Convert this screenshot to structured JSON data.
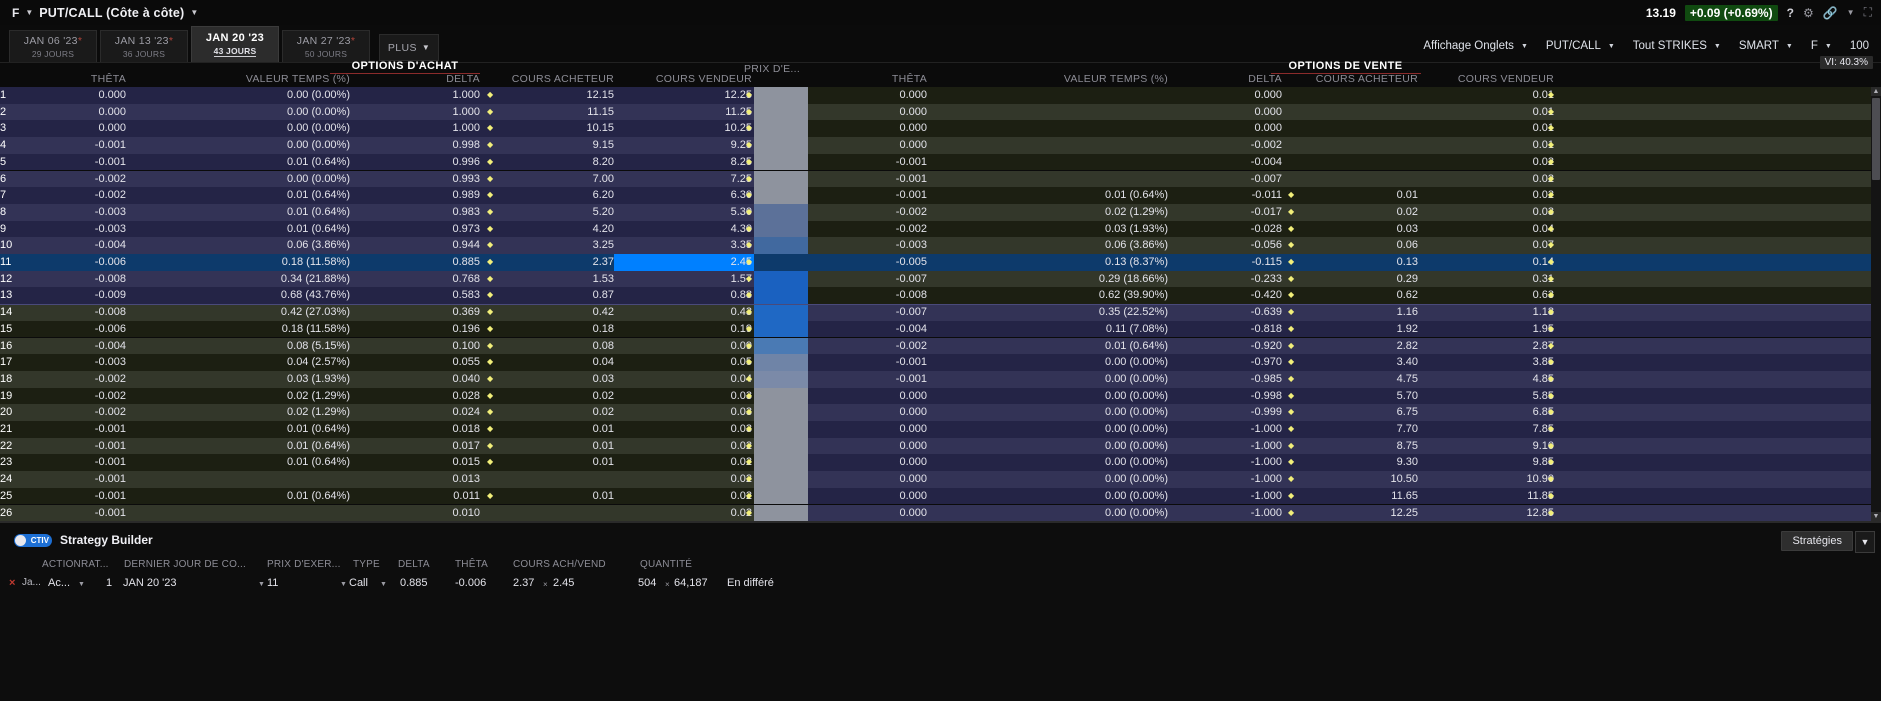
{
  "titlebar": {
    "symbol": "F",
    "title": "PUT/CALL (Côte à côte)",
    "quote_last": "13.19",
    "quote_change": "+0.09  (+0.69%)",
    "change_bg": "#104a10",
    "help_icon": "?",
    "gear_icon": "gear-icon",
    "link_icon": "link-icon",
    "expand_icon": "expand-icon"
  },
  "expiry_tabs": [
    {
      "date": "JAN 06 '23",
      "days": "29 JOURS",
      "selected": false,
      "asterisk": true
    },
    {
      "date": "JAN 13 '23",
      "days": "36 JOURS",
      "selected": false,
      "asterisk": true
    },
    {
      "date": "JAN 20 '23",
      "days": "43 JOURS",
      "selected": true,
      "asterisk": false
    },
    {
      "date": "JAN 27 '23",
      "days": "50 JOURS",
      "selected": false,
      "asterisk": true
    }
  ],
  "plus_tab": "PLUS",
  "toolbar": {
    "display_mode": "Affichage Onglets",
    "option_type": "PUT/CALL",
    "strikes": "Tout STRIKES",
    "exchange": "SMART",
    "symbol": "F",
    "quantity": "100",
    "vi_badge": "VI: 40.3%"
  },
  "sections": {
    "calls_title": "OPTIONS D'ACHAT",
    "puts_title": "OPTIONS DE VENTE",
    "strike_header": "PRIX D'E..."
  },
  "columns": {
    "theta": "THÊTA",
    "time_value": "VALEUR TEMPS (%)",
    "delta": "DELTA",
    "bid": "COURS ACHETEUR",
    "ask": "COURS VENDEUR"
  },
  "rows": [
    {
      "strike": "1",
      "c_theta": "0.000",
      "c_vt": "0.00 (0.00%)",
      "c_delta": "1.000",
      "c_bid": "12.15",
      "c_ask": "12.25",
      "p_theta": "0.000",
      "p_vt": "",
      "p_delta": "0.000",
      "p_bid": "",
      "p_ask": "0.01"
    },
    {
      "strike": "2",
      "c_theta": "0.000",
      "c_vt": "0.00 (0.00%)",
      "c_delta": "1.000",
      "c_bid": "11.15",
      "c_ask": "11.25",
      "p_theta": "0.000",
      "p_vt": "",
      "p_delta": "0.000",
      "p_bid": "",
      "p_ask": "0.01"
    },
    {
      "strike": "3",
      "c_theta": "0.000",
      "c_vt": "0.00 (0.00%)",
      "c_delta": "1.000",
      "c_bid": "10.15",
      "c_ask": "10.25",
      "p_theta": "0.000",
      "p_vt": "",
      "p_delta": "0.000",
      "p_bid": "",
      "p_ask": "0.01"
    },
    {
      "strike": "4",
      "c_theta": "-0.001",
      "c_vt": "0.00 (0.00%)",
      "c_delta": "0.998",
      "c_bid": "9.15",
      "c_ask": "9.25",
      "p_theta": "0.000",
      "p_vt": "",
      "p_delta": "-0.002",
      "p_bid": "",
      "p_ask": "0.01"
    },
    {
      "strike": "5",
      "c_theta": "-0.001",
      "c_vt": "0.01 (0.64%)",
      "c_delta": "0.996",
      "c_bid": "8.20",
      "c_ask": "8.25",
      "p_theta": "-0.001",
      "p_vt": "",
      "p_delta": "-0.004",
      "p_bid": "",
      "p_ask": "0.02"
    },
    {
      "strike": "6",
      "c_theta": "-0.002",
      "c_vt": "0.00 (0.00%)",
      "c_delta": "0.993",
      "c_bid": "7.00",
      "c_ask": "7.25",
      "p_theta": "-0.001",
      "p_vt": "",
      "p_delta": "-0.007",
      "p_bid": "",
      "p_ask": "0.02"
    },
    {
      "strike": "7",
      "c_theta": "-0.002",
      "c_vt": "0.01 (0.64%)",
      "c_delta": "0.989",
      "c_bid": "6.20",
      "c_ask": "6.30",
      "p_theta": "-0.001",
      "p_vt": "0.01 (0.64%)",
      "p_delta": "-0.011",
      "p_bid": "0.01",
      "p_ask": "0.02"
    },
    {
      "strike": "8",
      "c_theta": "-0.003",
      "c_vt": "0.01 (0.64%)",
      "c_delta": "0.983",
      "c_bid": "5.20",
      "c_ask": "5.30",
      "p_theta": "-0.002",
      "p_vt": "0.02 (1.29%)",
      "p_delta": "-0.017",
      "p_bid": "0.02",
      "p_ask": "0.03"
    },
    {
      "strike": "9",
      "c_theta": "-0.003",
      "c_vt": "0.01 (0.64%)",
      "c_delta": "0.973",
      "c_bid": "4.20",
      "c_ask": "4.30",
      "p_theta": "-0.002",
      "p_vt": "0.03 (1.93%)",
      "p_delta": "-0.028",
      "p_bid": "0.03",
      "p_ask": "0.04"
    },
    {
      "strike": "10",
      "c_theta": "-0.004",
      "c_vt": "0.06 (3.86%)",
      "c_delta": "0.944",
      "c_bid": "3.25",
      "c_ask": "3.35",
      "p_theta": "-0.003",
      "p_vt": "0.06 (3.86%)",
      "p_delta": "-0.056",
      "p_bid": "0.06",
      "p_ask": "0.07"
    },
    {
      "strike": "11",
      "c_theta": "-0.006",
      "c_vt": "0.18 (11.58%)",
      "c_delta": "0.885",
      "c_bid": "2.37",
      "c_ask": "2.45",
      "p_theta": "-0.005",
      "p_vt": "0.13 (8.37%)",
      "p_delta": "-0.115",
      "p_bid": "0.13",
      "p_ask": "0.14",
      "selected": true
    },
    {
      "strike": "12",
      "c_theta": "-0.008",
      "c_vt": "0.34 (21.88%)",
      "c_delta": "0.768",
      "c_bid": "1.53",
      "c_ask": "1.57",
      "p_theta": "-0.007",
      "p_vt": "0.29 (18.66%)",
      "p_delta": "-0.233",
      "p_bid": "0.29",
      "p_ask": "0.31"
    },
    {
      "strike": "13",
      "c_theta": "-0.009",
      "c_vt": "0.68 (43.76%)",
      "c_delta": "0.583",
      "c_bid": "0.87",
      "c_ask": "0.88",
      "p_theta": "-0.008",
      "p_vt": "0.62 (39.90%)",
      "p_delta": "-0.420",
      "p_bid": "0.62",
      "p_ask": "0.63"
    },
    {
      "strike": "14",
      "c_theta": "-0.008",
      "c_vt": "0.42 (27.03%)",
      "c_delta": "0.369",
      "c_bid": "0.42",
      "c_ask": "0.43",
      "p_theta": "-0.007",
      "p_vt": "0.35 (22.52%)",
      "p_delta": "-0.639",
      "p_bid": "1.16",
      "p_ask": "1.18"
    },
    {
      "strike": "15",
      "c_theta": "-0.006",
      "c_vt": "0.18 (11.58%)",
      "c_delta": "0.196",
      "c_bid": "0.18",
      "c_ask": "0.19",
      "p_theta": "-0.004",
      "p_vt": "0.11 (7.08%)",
      "p_delta": "-0.818",
      "p_bid": "1.92",
      "p_ask": "1.95"
    },
    {
      "strike": "16",
      "c_theta": "-0.004",
      "c_vt": "0.08 (5.15%)",
      "c_delta": "0.100",
      "c_bid": "0.08",
      "c_ask": "0.09",
      "p_theta": "-0.002",
      "p_vt": "0.01 (0.64%)",
      "p_delta": "-0.920",
      "p_bid": "2.82",
      "p_ask": "2.87"
    },
    {
      "strike": "17",
      "c_theta": "-0.003",
      "c_vt": "0.04 (2.57%)",
      "c_delta": "0.055",
      "c_bid": "0.04",
      "c_ask": "0.05",
      "p_theta": "-0.001",
      "p_vt": "0.00 (0.00%)",
      "p_delta": "-0.970",
      "p_bid": "3.40",
      "p_ask": "3.85"
    },
    {
      "strike": "18",
      "c_theta": "-0.002",
      "c_vt": "0.03 (1.93%)",
      "c_delta": "0.040",
      "c_bid": "0.03",
      "c_ask": "0.04",
      "p_theta": "-0.001",
      "p_vt": "0.00 (0.00%)",
      "p_delta": "-0.985",
      "p_bid": "4.75",
      "p_ask": "4.85"
    },
    {
      "strike": "19",
      "c_theta": "-0.002",
      "c_vt": "0.02 (1.29%)",
      "c_delta": "0.028",
      "c_bid": "0.02",
      "c_ask": "0.03",
      "p_theta": "0.000",
      "p_vt": "0.00 (0.00%)",
      "p_delta": "-0.998",
      "p_bid": "5.70",
      "p_ask": "5.85"
    },
    {
      "strike": "20",
      "c_theta": "-0.002",
      "c_vt": "0.02 (1.29%)",
      "c_delta": "0.024",
      "c_bid": "0.02",
      "c_ask": "0.03",
      "p_theta": "0.000",
      "p_vt": "0.00 (0.00%)",
      "p_delta": "-0.999",
      "p_bid": "6.75",
      "p_ask": "6.85"
    },
    {
      "strike": "21",
      "c_theta": "-0.001",
      "c_vt": "0.01 (0.64%)",
      "c_delta": "0.018",
      "c_bid": "0.01",
      "c_ask": "0.03",
      "p_theta": "0.000",
      "p_vt": "0.00 (0.00%)",
      "p_delta": "-1.000",
      "p_bid": "7.70",
      "p_ask": "7.85"
    },
    {
      "strike": "22",
      "c_theta": "-0.001",
      "c_vt": "0.01 (0.64%)",
      "c_delta": "0.017",
      "c_bid": "0.01",
      "c_ask": "0.02",
      "p_theta": "0.000",
      "p_vt": "0.00 (0.00%)",
      "p_delta": "-1.000",
      "p_bid": "8.75",
      "p_ask": "9.10"
    },
    {
      "strike": "23",
      "c_theta": "-0.001",
      "c_vt": "0.01 (0.64%)",
      "c_delta": "0.015",
      "c_bid": "0.01",
      "c_ask": "0.02",
      "p_theta": "0.000",
      "p_vt": "0.00 (0.00%)",
      "p_delta": "-1.000",
      "p_bid": "9.30",
      "p_ask": "9.85"
    },
    {
      "strike": "24",
      "c_theta": "-0.001",
      "c_vt": "",
      "c_delta": "0.013",
      "c_bid": "",
      "c_ask": "0.02",
      "p_theta": "0.000",
      "p_vt": "0.00 (0.00%)",
      "p_delta": "-1.000",
      "p_bid": "10.50",
      "p_ask": "10.90"
    },
    {
      "strike": "25",
      "c_theta": "-0.001",
      "c_vt": "0.01 (0.64%)",
      "c_delta": "0.011",
      "c_bid": "0.01",
      "c_ask": "0.02",
      "p_theta": "0.000",
      "p_vt": "0.00 (0.00%)",
      "p_delta": "-1.000",
      "p_bid": "11.65",
      "p_ask": "11.85"
    },
    {
      "strike": "26",
      "c_theta": "-0.001",
      "c_vt": "",
      "c_delta": "0.010",
      "c_bid": "",
      "c_ask": "0.02",
      "p_theta": "0.000",
      "p_vt": "0.00 (0.00%)",
      "p_delta": "-1.000",
      "p_bid": "12.25",
      "p_ask": "12.85"
    }
  ],
  "strategy_builder": {
    "badge": "CTIV",
    "title": "Strategy Builder",
    "strategies_button": "Stratégies",
    "strategies_caret": "▼",
    "headers": {
      "action_ratio": "ACTIONRAT...",
      "last_day": "DERNIER JOUR DE CO...",
      "strike": "PRIX D'EXER...",
      "type": "TYPE",
      "delta": "DELTA",
      "theta": "THÊTA",
      "bid_ask": "COURS ACH/VEND",
      "quantity": "QUANTITÉ"
    },
    "leg": {
      "close_icon": "×",
      "instrument": "Ja...",
      "action": "Ac...",
      "ratio": "1",
      "last_day": "JAN 20 '23",
      "strike": "11",
      "type": "Call",
      "delta": "0.885",
      "theta": "-0.006",
      "bid": "2.37",
      "ask": "2.45",
      "qty_bid": "504",
      "qty_ask": "64,187",
      "status": "En différé"
    }
  }
}
